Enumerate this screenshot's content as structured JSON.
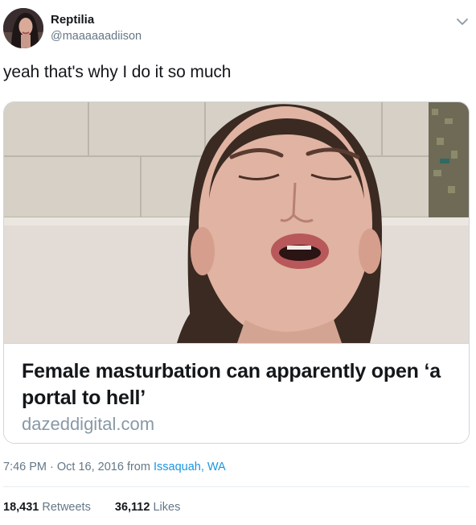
{
  "author": {
    "display_name": "Reptilia",
    "handle": "@maaaaaadiison"
  },
  "tweet": {
    "text": "yeah that's why I do it so much"
  },
  "card": {
    "title": "Female masturbation can apparently open ‘a portal to hell’",
    "domain": "dazeddigital.com"
  },
  "meta": {
    "time": "7:46 PM",
    "separator": " · ",
    "date": "Oct 16, 2016",
    "from_label": " from ",
    "source": "Issaquah, WA"
  },
  "stats": {
    "retweets_count": "18,431",
    "retweets_label": "Retweets",
    "likes_count": "36,112",
    "likes_label": "Likes"
  },
  "icons": {
    "caret": "chevron-down-icon",
    "avatar": "avatar-photo"
  },
  "colors": {
    "link": "#1b95e0",
    "muted": "#657786",
    "text": "#14171a",
    "border": "#ccd6dd"
  }
}
